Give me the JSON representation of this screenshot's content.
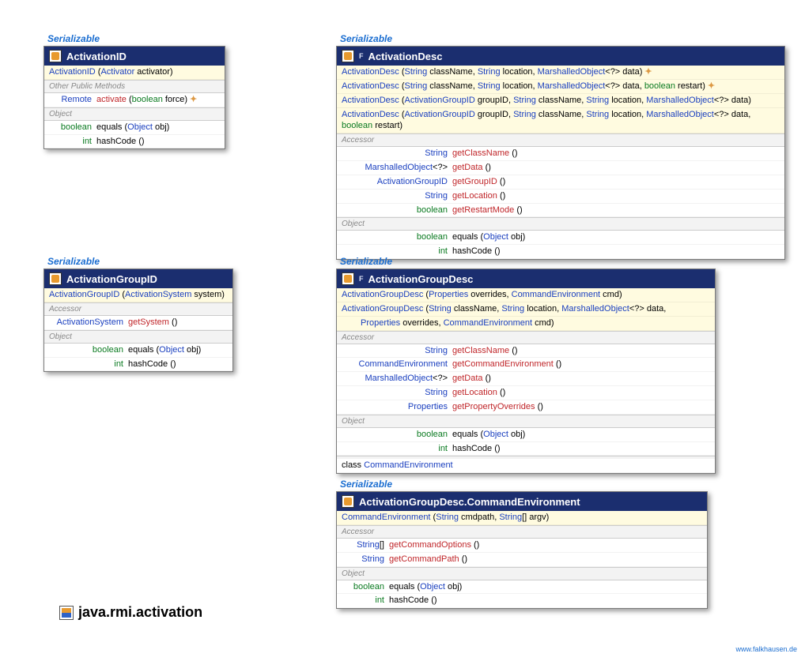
{
  "serializable": "Serializable",
  "package": "java.rmi.activation",
  "footer": "www.falkhausen.de",
  "classes": {
    "aid": {
      "title": "ActivationID",
      "ctors": [
        [
          [
            "type",
            "ActivationID"
          ],
          [
            "plain",
            " ("
          ],
          [
            "param",
            "Activator"
          ],
          [
            "plain",
            " activator)"
          ]
        ]
      ],
      "sections": [
        {
          "label": "Other Public Methods",
          "rows": [
            {
              "left": [
                [
                  "param",
                  "Remote"
                ]
              ],
              "right": [
                [
                  "method",
                  "activate"
                ],
                [
                  "plain",
                  " ("
                ],
                [
                  "kw",
                  "boolean"
                ],
                [
                  "plain",
                  " force) "
                ],
                [
                  "sym",
                  "✦"
                ]
              ]
            }
          ]
        },
        {
          "label": "Object",
          "rows": [
            {
              "left": [
                [
                  "kw",
                  "boolean"
                ]
              ],
              "right": [
                [
                  "plain",
                  "equals ("
                ],
                [
                  "param",
                  "Object"
                ],
                [
                  "plain",
                  " obj)"
                ]
              ]
            },
            {
              "left": [
                [
                  "kw",
                  "int"
                ]
              ],
              "right": [
                [
                  "plain",
                  "hashCode ()"
                ]
              ]
            }
          ]
        }
      ]
    },
    "adesc": {
      "title": "ActivationDesc",
      "mod": "F",
      "ctors": [
        [
          [
            "type",
            "ActivationDesc"
          ],
          [
            "plain",
            " ("
          ],
          [
            "param",
            "String"
          ],
          [
            "plain",
            " className, "
          ],
          [
            "param",
            "String"
          ],
          [
            "plain",
            " location, "
          ],
          [
            "param",
            "MarshalledObject"
          ],
          [
            "plain",
            "<?> data) "
          ],
          [
            "sym",
            "✦"
          ]
        ],
        [
          [
            "type",
            "ActivationDesc"
          ],
          [
            "plain",
            " ("
          ],
          [
            "param",
            "String"
          ],
          [
            "plain",
            " className, "
          ],
          [
            "param",
            "String"
          ],
          [
            "plain",
            " location, "
          ],
          [
            "param",
            "MarshalledObject"
          ],
          [
            "plain",
            "<?> data, "
          ],
          [
            "kw",
            "boolean"
          ],
          [
            "plain",
            " restart) "
          ],
          [
            "sym",
            "✦"
          ]
        ],
        [
          [
            "type",
            "ActivationDesc"
          ],
          [
            "plain",
            " ("
          ],
          [
            "param",
            "ActivationGroupID"
          ],
          [
            "plain",
            " groupID, "
          ],
          [
            "param",
            "String"
          ],
          [
            "plain",
            " className, "
          ],
          [
            "param",
            "String"
          ],
          [
            "plain",
            " location, "
          ],
          [
            "param",
            "MarshalledObject"
          ],
          [
            "plain",
            "<?> data)"
          ]
        ],
        [
          [
            "type",
            "ActivationDesc"
          ],
          [
            "plain",
            " ("
          ],
          [
            "param",
            "ActivationGroupID"
          ],
          [
            "plain",
            " groupID, "
          ],
          [
            "param",
            "String"
          ],
          [
            "plain",
            " className, "
          ],
          [
            "param",
            "String"
          ],
          [
            "plain",
            " location, "
          ],
          [
            "param",
            "MarshalledObject"
          ],
          [
            "plain",
            "<?> data, "
          ],
          [
            "kw",
            "boolean"
          ],
          [
            "plain",
            " restart)"
          ]
        ]
      ],
      "sections": [
        {
          "label": "Accessor",
          "rows": [
            {
              "left": [
                [
                  "param",
                  "String"
                ]
              ],
              "right": [
                [
                  "method",
                  "getClassName"
                ],
                [
                  "plain",
                  " ()"
                ]
              ]
            },
            {
              "left": [
                [
                  "param",
                  "MarshalledObject"
                ],
                [
                  "plain",
                  "<?>"
                ]
              ],
              "right": [
                [
                  "method",
                  "getData"
                ],
                [
                  "plain",
                  " ()"
                ]
              ]
            },
            {
              "left": [
                [
                  "param",
                  "ActivationGroupID"
                ]
              ],
              "right": [
                [
                  "method",
                  "getGroupID"
                ],
                [
                  "plain",
                  " ()"
                ]
              ]
            },
            {
              "left": [
                [
                  "param",
                  "String"
                ]
              ],
              "right": [
                [
                  "method",
                  "getLocation"
                ],
                [
                  "plain",
                  " ()"
                ]
              ]
            },
            {
              "left": [
                [
                  "kw",
                  "boolean"
                ]
              ],
              "right": [
                [
                  "method",
                  "getRestartMode"
                ],
                [
                  "plain",
                  " ()"
                ]
              ]
            }
          ]
        },
        {
          "label": "Object",
          "rows": [
            {
              "left": [
                [
                  "kw",
                  "boolean"
                ]
              ],
              "right": [
                [
                  "plain",
                  "equals ("
                ],
                [
                  "param",
                  "Object"
                ],
                [
                  "plain",
                  " obj)"
                ]
              ]
            },
            {
              "left": [
                [
                  "kw",
                  "int"
                ]
              ],
              "right": [
                [
                  "plain",
                  "hashCode ()"
                ]
              ]
            }
          ]
        }
      ]
    },
    "agid": {
      "title": "ActivationGroupID",
      "ctors": [
        [
          [
            "type",
            "ActivationGroupID"
          ],
          [
            "plain",
            " ("
          ],
          [
            "param",
            "ActivationSystem"
          ],
          [
            "plain",
            " system)"
          ]
        ]
      ],
      "sections": [
        {
          "label": "Accessor",
          "rows": [
            {
              "left": [
                [
                  "param",
                  "ActivationSystem"
                ]
              ],
              "right": [
                [
                  "method",
                  "getSystem"
                ],
                [
                  "plain",
                  " ()"
                ]
              ]
            }
          ]
        },
        {
          "label": "Object",
          "rows": [
            {
              "left": [
                [
                  "kw",
                  "boolean"
                ]
              ],
              "right": [
                [
                  "plain",
                  "equals ("
                ],
                [
                  "param",
                  "Object"
                ],
                [
                  "plain",
                  " obj)"
                ]
              ]
            },
            {
              "left": [
                [
                  "kw",
                  "int"
                ]
              ],
              "right": [
                [
                  "plain",
                  "hashCode ()"
                ]
              ]
            }
          ]
        }
      ]
    },
    "agdesc": {
      "title": "ActivationGroupDesc",
      "mod": "F",
      "ctors": [
        [
          [
            "type",
            "ActivationGroupDesc"
          ],
          [
            "plain",
            " ("
          ],
          [
            "param",
            "Properties"
          ],
          [
            "plain",
            " overrides, "
          ],
          [
            "param",
            "CommandEnvironment"
          ],
          [
            "plain",
            " cmd)"
          ]
        ],
        [
          [
            "type",
            "ActivationGroupDesc"
          ],
          [
            "plain",
            " ("
          ],
          [
            "param",
            "String"
          ],
          [
            "plain",
            " className, "
          ],
          [
            "param",
            "String"
          ],
          [
            "plain",
            " location, "
          ],
          [
            "param",
            "MarshalledObject"
          ],
          [
            "plain",
            "<?> data,"
          ]
        ]
      ],
      "ctor_cont": [
        [
          "param",
          "Properties"
        ],
        [
          "plain",
          " overrides, "
        ],
        [
          "param",
          "CommandEnvironment"
        ],
        [
          "plain",
          " cmd)"
        ]
      ],
      "sections": [
        {
          "label": "Accessor",
          "rows": [
            {
              "left": [
                [
                  "param",
                  "String"
                ]
              ],
              "right": [
                [
                  "method",
                  "getClassName"
                ],
                [
                  "plain",
                  " ()"
                ]
              ]
            },
            {
              "left": [
                [
                  "param",
                  "CommandEnvironment"
                ]
              ],
              "right": [
                [
                  "method",
                  "getCommandEnvironment"
                ],
                [
                  "plain",
                  " ()"
                ]
              ]
            },
            {
              "left": [
                [
                  "param",
                  "MarshalledObject"
                ],
                [
                  "plain",
                  "<?>"
                ]
              ],
              "right": [
                [
                  "method",
                  "getData"
                ],
                [
                  "plain",
                  " ()"
                ]
              ]
            },
            {
              "left": [
                [
                  "param",
                  "String"
                ]
              ],
              "right": [
                [
                  "method",
                  "getLocation"
                ],
                [
                  "plain",
                  " ()"
                ]
              ]
            },
            {
              "left": [
                [
                  "param",
                  "Properties"
                ]
              ],
              "right": [
                [
                  "method",
                  "getPropertyOverrides"
                ],
                [
                  "plain",
                  " ()"
                ]
              ]
            }
          ]
        },
        {
          "label": "Object",
          "rows": [
            {
              "left": [
                [
                  "kw",
                  "boolean"
                ]
              ],
              "right": [
                [
                  "plain",
                  "equals ("
                ],
                [
                  "param",
                  "Object"
                ],
                [
                  "plain",
                  " obj)"
                ]
              ]
            },
            {
              "left": [
                [
                  "kw",
                  "int"
                ]
              ],
              "right": [
                [
                  "plain",
                  "hashCode ()"
                ]
              ]
            }
          ]
        }
      ],
      "inner": [
        [
          "plain",
          "class "
        ],
        [
          "type",
          "CommandEnvironment"
        ]
      ]
    },
    "ce": {
      "title": "ActivationGroupDesc.CommandEnvironment",
      "ctors": [
        [
          [
            "type",
            "CommandEnvironment"
          ],
          [
            "plain",
            " ("
          ],
          [
            "param",
            "String"
          ],
          [
            "plain",
            " cmdpath, "
          ],
          [
            "param",
            "String"
          ],
          [
            "plain",
            "[] argv)"
          ]
        ]
      ],
      "sections": [
        {
          "label": "Accessor",
          "rows": [
            {
              "left": [
                [
                  "param",
                  "String"
                ],
                [
                  "plain",
                  "[]"
                ]
              ],
              "right": [
                [
                  "method",
                  "getCommandOptions"
                ],
                [
                  "plain",
                  " ()"
                ]
              ]
            },
            {
              "left": [
                [
                  "param",
                  "String"
                ]
              ],
              "right": [
                [
                  "method",
                  "getCommandPath"
                ],
                [
                  "plain",
                  " ()"
                ]
              ]
            }
          ]
        },
        {
          "label": "Object",
          "rows": [
            {
              "left": [
                [
                  "kw",
                  "boolean"
                ]
              ],
              "right": [
                [
                  "plain",
                  "equals ("
                ],
                [
                  "param",
                  "Object"
                ],
                [
                  "plain",
                  " obj)"
                ]
              ]
            },
            {
              "left": [
                [
                  "kw",
                  "int"
                ]
              ],
              "right": [
                [
                  "plain",
                  "hashCode ()"
                ]
              ]
            }
          ]
        }
      ]
    }
  }
}
